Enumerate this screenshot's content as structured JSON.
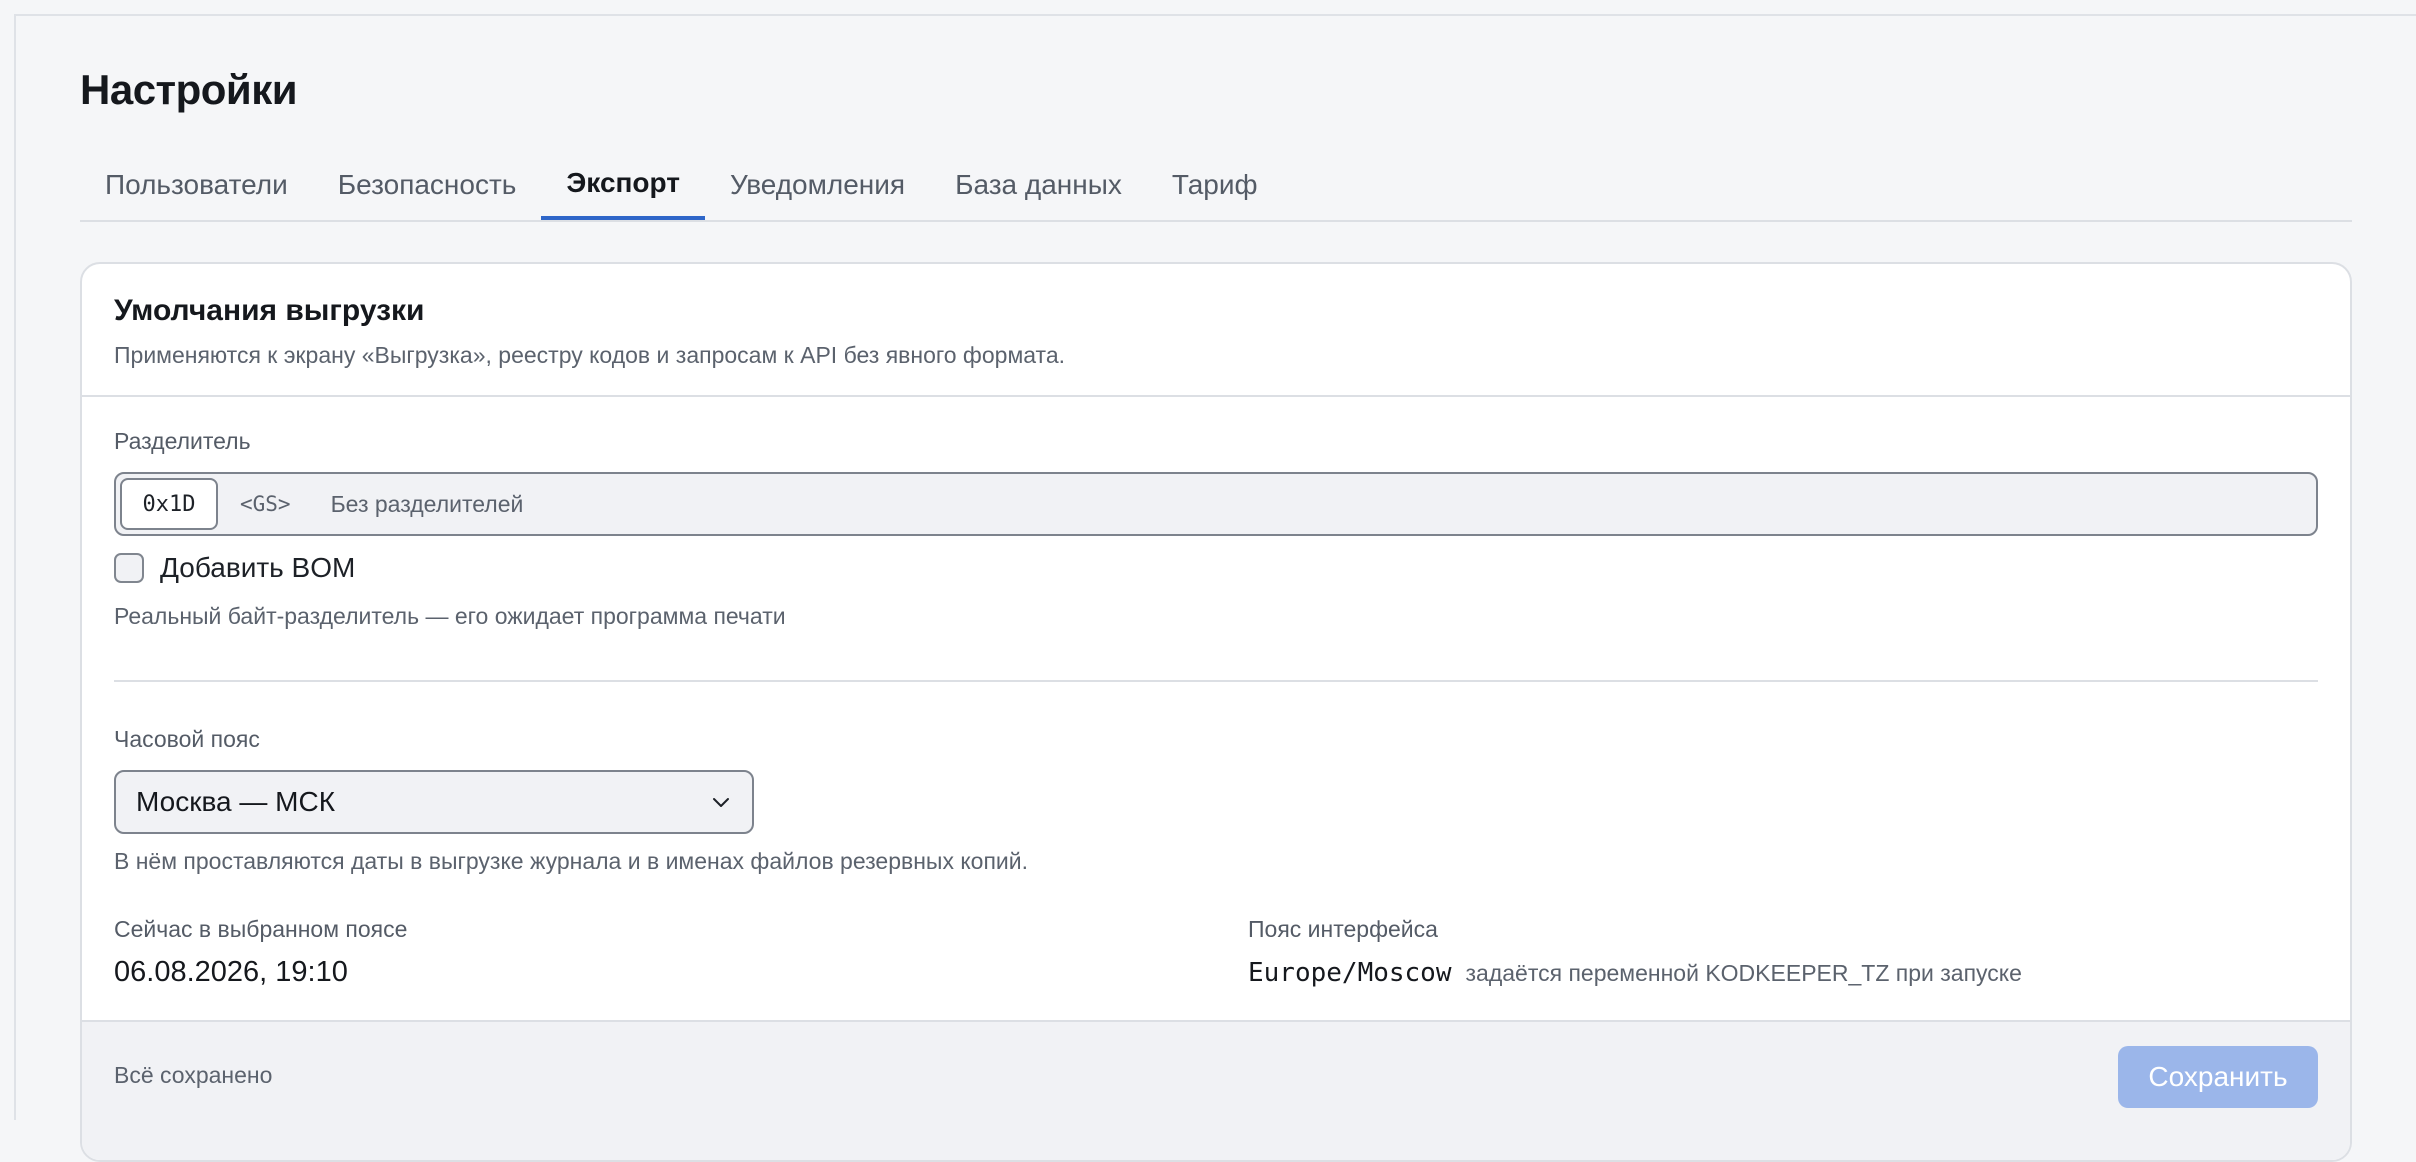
{
  "page": {
    "title": "Настройки"
  },
  "tabs": [
    {
      "label": "Пользователи",
      "active": false
    },
    {
      "label": "Безопасность",
      "active": false
    },
    {
      "label": "Экспорт",
      "active": true
    },
    {
      "label": "Уведомления",
      "active": false
    },
    {
      "label": "База данных",
      "active": false
    },
    {
      "label": "Тариф",
      "active": false
    }
  ],
  "card": {
    "title": "Умолчания выгрузки",
    "subtitle": "Применяются к экрану «Выгрузка», реестру кодов и запросам к API без явного формата."
  },
  "separator": {
    "label": "Разделитель",
    "selected_value": "0x1D",
    "code": "<GS>",
    "description": "Без разделителей"
  },
  "bom": {
    "label": "Добавить BOM",
    "checked": false
  },
  "separator_hint": "Реальный байт-разделитель — его ожидает программа печати",
  "timezone": {
    "label": "Часовой пояс",
    "selected": "Москва — МСК",
    "hint": "В нём проставляются даты в выгрузке журнала и в именах файлов резервных копий.",
    "chevron_icon": "chevron-down-icon"
  },
  "now_info": {
    "label": "Сейчас в выбранном поясе",
    "value": "06.08.2026, 19:10"
  },
  "interface_tz": {
    "label": "Пояс интерфейса",
    "value": "Europe/Moscow",
    "note": "задаётся переменной KODKEEPER_TZ при запуске"
  },
  "footer": {
    "status": "Всё сохранено",
    "save_label": "Сохранить",
    "save_enabled": false
  },
  "colors": {
    "accent": "#2e66c9",
    "save_disabled": "#9bb6ea",
    "background": "#f5f6f8"
  }
}
